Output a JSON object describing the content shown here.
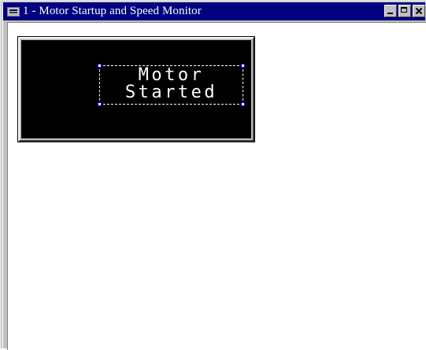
{
  "window": {
    "title": "1 - Motor Startup and Speed Monitor",
    "icon": "app-window-icon",
    "buttons": [
      "minimize-icon",
      "maximize-icon",
      "close-icon"
    ]
  },
  "display": {
    "line1": "Motor",
    "line2": "Started"
  },
  "colors": {
    "titlebar": "#000080",
    "display_background": "#000000",
    "display_text": "#ffffff"
  }
}
